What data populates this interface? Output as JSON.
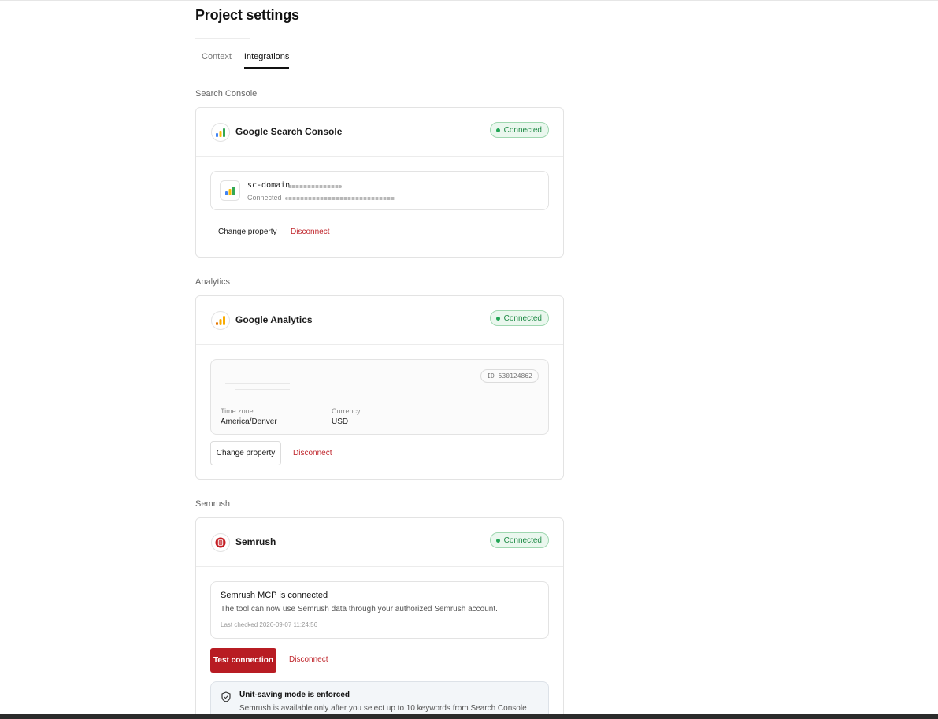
{
  "page": {
    "title": "Project settings"
  },
  "tabs": [
    {
      "label": "Context",
      "active": false
    },
    {
      "label": "Integrations",
      "active": true
    }
  ],
  "status_connected": "Connected",
  "colors": {
    "accent_red": "#b81c23",
    "success_green": "#1e8a45",
    "disconnect_red": "#c0272d"
  },
  "search_console": {
    "section_label": "Search Console",
    "provider_name": "Google Search Console",
    "icon": "google-search-console-icon",
    "property_name": "sc-domain",
    "property_status_prefix": "Connected",
    "change_label": "Change property",
    "disconnect_label": "Disconnect"
  },
  "analytics": {
    "section_label": "Analytics",
    "provider_name": "Google Analytics",
    "icon": "google-analytics-icon",
    "property_id": "ID 530124862",
    "timezone_label": "Time zone",
    "timezone_value": "America/Denver",
    "currency_label": "Currency",
    "currency_value": "USD",
    "change_label": "Change property",
    "disconnect_label": "Disconnect"
  },
  "semrush": {
    "section_label": "Semrush",
    "provider_name": "Semrush",
    "icon": "semrush-icon",
    "status_title": "Semrush MCP is connected",
    "status_description": "The tool can now use Semrush data through your authorized Semrush account.",
    "last_checked": "Last checked 2026-09-07 11:24:56",
    "test_label": "Test connection",
    "disconnect_label": "Disconnect",
    "notice_title": "Unit-saving mode is enforced",
    "notice_text": "Semrush is available only after you select up to 10 keywords from Search Console"
  }
}
